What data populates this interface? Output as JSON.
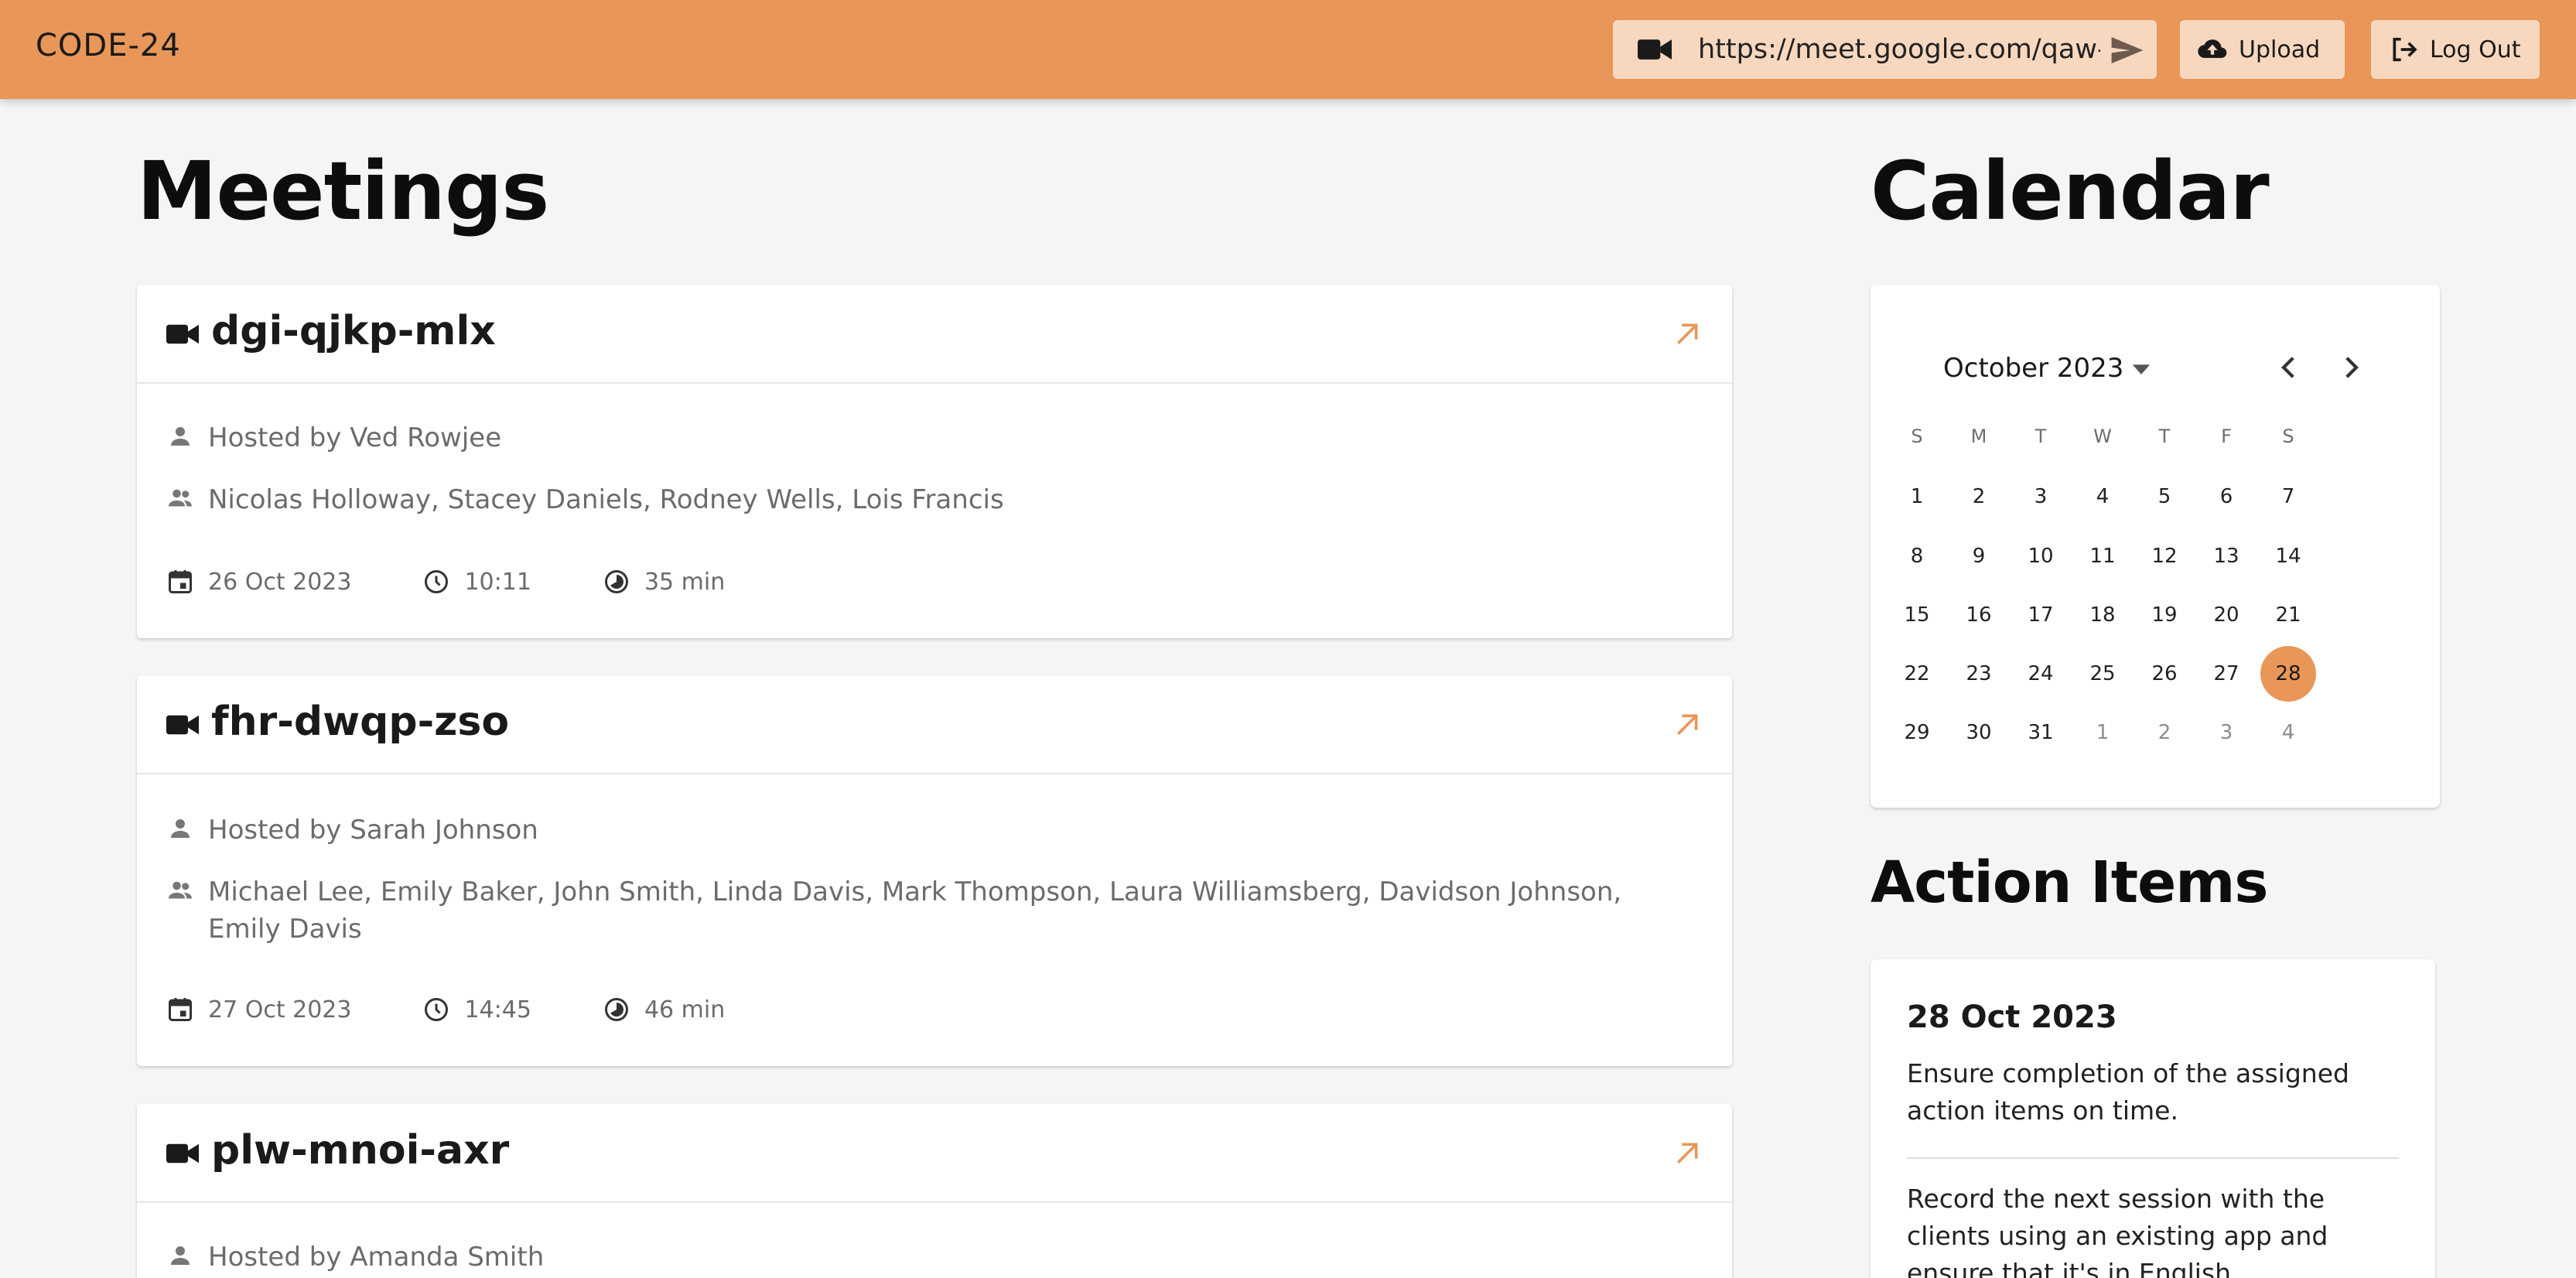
{
  "header": {
    "brand": "CODE-24",
    "meeting_url_value": "https://meet.google.com/qaw-",
    "upload_label": "Upload",
    "logout_label": "Log Out",
    "accent_color": "#e89758"
  },
  "meetings_section": {
    "title": "Meetings",
    "items": [
      {
        "code": "dgi-qjkp-mlx",
        "host": "Hosted by Ved Rowjee",
        "participants": "Nicolas Holloway, Stacey Daniels, Rodney Wells, Lois Francis",
        "date": "26 Oct 2023",
        "time": "10:11",
        "duration": "35 min"
      },
      {
        "code": "fhr-dwqp-zso",
        "host": "Hosted by Sarah Johnson",
        "participants_line1": "Michael Lee, Emily Baker, John Smith, Linda Davis, Mark Thompson, Laura Williamsberg, Davidson Johnson,",
        "participants_line2": "Emily Davis",
        "date": "27 Oct 2023",
        "time": "14:45",
        "duration": "46 min"
      },
      {
        "code": "plw-mnoi-axr",
        "host": "Hosted by Amanda Smith"
      }
    ]
  },
  "calendar_section": {
    "title": "Calendar",
    "month_label": "October 2023",
    "weekdays": [
      "S",
      "M",
      "T",
      "W",
      "T",
      "F",
      "S"
    ],
    "weeks": [
      [
        "1",
        "2",
        "3",
        "4",
        "5",
        "6",
        "7"
      ],
      [
        "8",
        "9",
        "10",
        "11",
        "12",
        "13",
        "14"
      ],
      [
        "15",
        "16",
        "17",
        "18",
        "19",
        "20",
        "21"
      ],
      [
        "22",
        "23",
        "24",
        "25",
        "26",
        "27",
        "28"
      ],
      [
        "29",
        "30",
        "31",
        "1",
        "2",
        "3",
        "4"
      ]
    ],
    "selected_day": "28"
  },
  "action_items_section": {
    "title": "Action Items",
    "date": "28 Oct 2023",
    "item1": "Ensure completion of the assigned action items on time.",
    "item2": "Record the next session with the clients using an existing app and ensure that it's in English."
  }
}
